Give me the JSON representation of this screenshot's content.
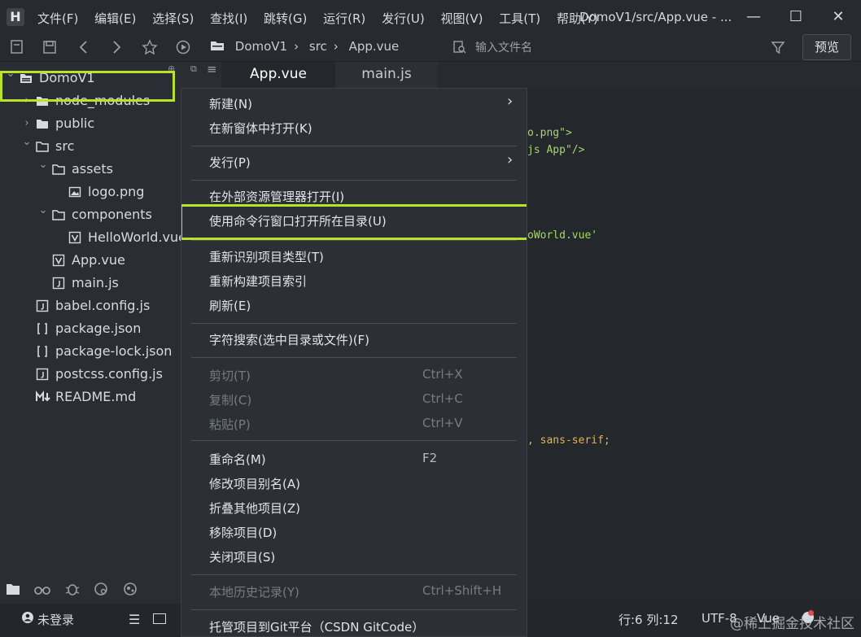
{
  "app": {
    "logo": "H"
  },
  "menubar": [
    "文件(F)",
    "编辑(E)",
    "选择(S)",
    "查找(I)",
    "跳转(G)",
    "运行(R)",
    "发行(U)",
    "视图(V)",
    "工具(T)",
    "帮助(Y)"
  ],
  "window": {
    "title": "DomoV1/src/App.vue - ...",
    "minimize": "—",
    "maximize": "☐",
    "close": "✕"
  },
  "toolbar": {
    "breadcrumb": [
      "DomoV1",
      "src",
      "App.vue"
    ],
    "search_placeholder": "输入文件名",
    "preview_label": "预览"
  },
  "sidebar": {
    "tree": [
      {
        "label": "DomoV1",
        "icon": "project-icon",
        "chevron": "down",
        "depth": 0
      },
      {
        "label": "node_modules",
        "icon": "folder-icon",
        "chevron": "right",
        "depth": 1
      },
      {
        "label": "public",
        "icon": "folder-icon",
        "chevron": "right",
        "depth": 1
      },
      {
        "label": "src",
        "icon": "folder-open-icon",
        "chevron": "down",
        "depth": 1
      },
      {
        "label": "assets",
        "icon": "folder-open-icon",
        "chevron": "down",
        "depth": 2
      },
      {
        "label": "logo.png",
        "icon": "image-file-icon",
        "chevron": "",
        "depth": 3
      },
      {
        "label": "components",
        "icon": "folder-open-icon",
        "chevron": "down",
        "depth": 2
      },
      {
        "label": "HelloWorld.vue",
        "icon": "vue-file-icon",
        "chevron": "",
        "depth": 3
      },
      {
        "label": "App.vue",
        "icon": "vue-file-icon",
        "chevron": "",
        "depth": 2
      },
      {
        "label": "main.js",
        "icon": "js-file-icon",
        "chevron": "",
        "depth": 2
      },
      {
        "label": "babel.config.js",
        "icon": "js-file-icon",
        "chevron": "",
        "depth": 1
      },
      {
        "label": "package.json",
        "icon": "json-file-icon",
        "chevron": "",
        "depth": 1
      },
      {
        "label": "package-lock.json",
        "icon": "json-file-icon",
        "chevron": "",
        "depth": 1
      },
      {
        "label": "postcss.config.js",
        "icon": "js-file-icon",
        "chevron": "",
        "depth": 1
      },
      {
        "label": "README.md",
        "icon": "markdown-file-icon",
        "chevron": "",
        "depth": 1
      }
    ]
  },
  "editor": {
    "tabs": [
      {
        "label": "App.vue",
        "active": true
      },
      {
        "label": "main.js",
        "active": false
      }
    ],
    "code_fragments": [
      {
        "text": "o.png\">"
      },
      {
        "text": "js App\"/>"
      },
      {
        "text": "oWorld.vue'"
      },
      {
        "text": ", sans-serif;"
      }
    ]
  },
  "context_menu": {
    "items": [
      {
        "label": "新建(N)",
        "shortcut": "",
        "submenu": true,
        "disabled": false
      },
      {
        "label": "在新窗体中打开(K)",
        "shortcut": "",
        "submenu": false,
        "disabled": false
      },
      {
        "label": "发行(P)",
        "shortcut": "",
        "submenu": true,
        "disabled": false
      },
      {
        "label": "在外部资源管理器打开(I)",
        "shortcut": "",
        "submenu": false,
        "disabled": false
      },
      {
        "label": "使用命令行窗口打开所在目录(U)",
        "shortcut": "",
        "submenu": false,
        "disabled": false
      },
      {
        "label": "重新识别项目类型(T)",
        "shortcut": "",
        "submenu": false,
        "disabled": false
      },
      {
        "label": "重新构建项目索引",
        "shortcut": "",
        "submenu": false,
        "disabled": false
      },
      {
        "label": "刷新(E)",
        "shortcut": "",
        "submenu": false,
        "disabled": false
      },
      {
        "label": "字符搜索(选中目录或文件)(F)",
        "shortcut": "",
        "submenu": false,
        "disabled": false
      },
      {
        "label": "剪切(T)",
        "shortcut": "Ctrl+X",
        "submenu": false,
        "disabled": true
      },
      {
        "label": "复制(C)",
        "shortcut": "Ctrl+C",
        "submenu": false,
        "disabled": true
      },
      {
        "label": "粘贴(P)",
        "shortcut": "Ctrl+V",
        "submenu": false,
        "disabled": true
      },
      {
        "label": "重命名(M)",
        "shortcut": "F2",
        "submenu": false,
        "disabled": false
      },
      {
        "label": "修改项目别名(A)",
        "shortcut": "",
        "submenu": false,
        "disabled": false
      },
      {
        "label": "折叠其他项目(Z)",
        "shortcut": "",
        "submenu": false,
        "disabled": false
      },
      {
        "label": "移除项目(D)",
        "shortcut": "",
        "submenu": false,
        "disabled": false
      },
      {
        "label": "关闭项目(S)",
        "shortcut": "",
        "submenu": false,
        "disabled": false
      },
      {
        "label": "本地历史记录(Y)",
        "shortcut": "Ctrl+Shift+H",
        "submenu": false,
        "disabled": true
      },
      {
        "label": "托管项目到Git平台（CSDN GitCode）",
        "shortcut": "",
        "submenu": false,
        "disabled": false
      }
    ],
    "submenu_arrow": "›"
  },
  "statusbar": {
    "login": "未登录",
    "cursor": "行:6  列:12",
    "encoding": "UTF-8",
    "language": "Vue"
  },
  "watermark": "@稀土掘金技术社区",
  "colors": {
    "highlight": "#b9e22c",
    "string": "#a6d66b",
    "keyword": "#e6b450"
  }
}
